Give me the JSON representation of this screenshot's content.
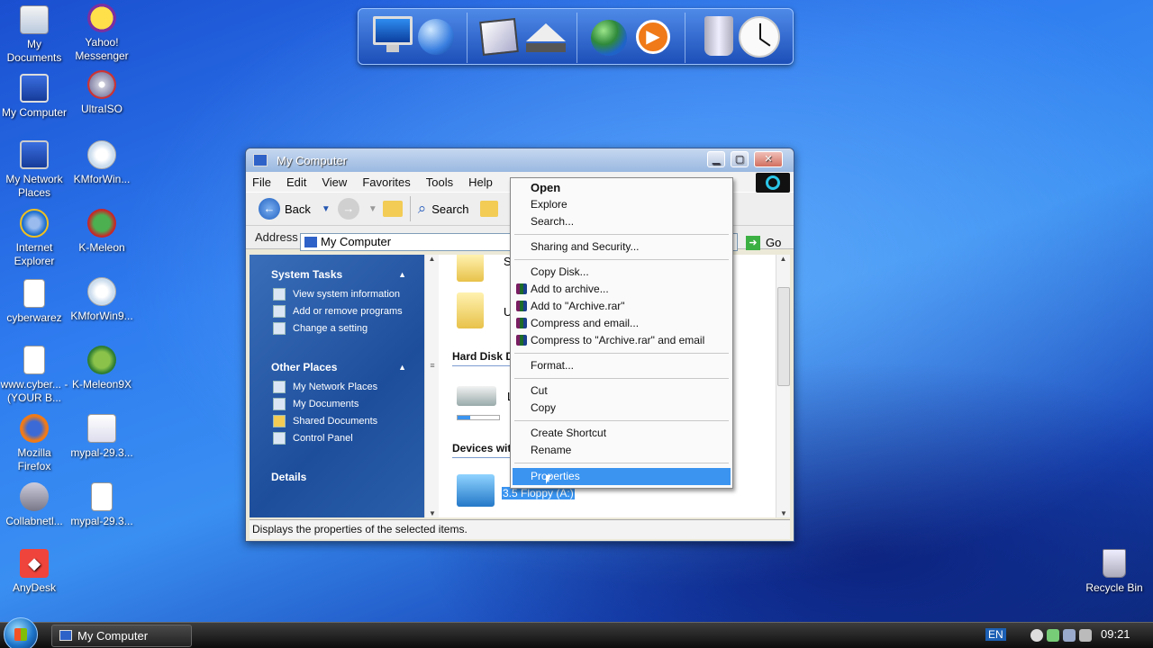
{
  "desktop": {
    "icons": [
      {
        "label": "My Documents",
        "icon": "my-documents-icon"
      },
      {
        "label": "Yahoo! Messenger",
        "icon": "yahoo-messenger-icon"
      },
      {
        "label": "My Computer",
        "icon": "my-computer-icon"
      },
      {
        "label": "UltraISO",
        "icon": "ultraiso-icon"
      },
      {
        "label": "My Network Places",
        "icon": "network-places-icon"
      },
      {
        "label": "KMforWin...",
        "icon": "kmforwin-icon"
      },
      {
        "label": "Internet Explorer",
        "icon": "internet-explorer-icon"
      },
      {
        "label": "K-Meleon",
        "icon": "k-meleon-icon"
      },
      {
        "label": "cyberwarez",
        "icon": "text-file-icon"
      },
      {
        "label": "KMforWin9...",
        "icon": "kmforwin-icon"
      },
      {
        "label": "www.cyber... - (YOUR B...",
        "icon": "shortcut-icon"
      },
      {
        "label": "K-Meleon9X",
        "icon": "k-meleon-icon"
      },
      {
        "label": "Mozilla Firefox",
        "icon": "firefox-icon"
      },
      {
        "label": "mypal-29.3...",
        "icon": "mypal-icon"
      },
      {
        "label": "Collabnetl...",
        "icon": "collabnet-icon"
      },
      {
        "label": "mypal-29.3...",
        "icon": "file-icon"
      },
      {
        "label": "AnyDesk",
        "icon": "anydesk-icon"
      },
      {
        "label": "Recycle Bin",
        "icon": "recycle-bin-icon"
      }
    ]
  },
  "dock": {
    "items": [
      "monitor-icon",
      "globe-network-icon",
      "drawing-tools-icon",
      "eject-drive-icon",
      "earth-icon",
      "media-player-icon",
      "trash-icon",
      "clock-icon"
    ]
  },
  "window": {
    "title": "My Computer",
    "menu": [
      "File",
      "Edit",
      "View",
      "Favorites",
      "Tools",
      "Help"
    ],
    "toolbar": {
      "back": "Back",
      "search": "Search"
    },
    "address": {
      "label": "Address",
      "value": "My Computer",
      "go": "Go"
    },
    "left_pane": {
      "system_tasks": {
        "title": "System Tasks",
        "items": [
          "View system information",
          "Add or remove programs",
          "Change a setting"
        ]
      },
      "other_places": {
        "title": "Other Places",
        "items": [
          "My Network Places",
          "My Documents",
          "Shared Documents",
          "Control Panel"
        ]
      },
      "details": {
        "title": "Details"
      }
    },
    "right_pane": {
      "folder1": "Sh",
      "folder2": "U",
      "hard_disk_header": "Hard Disk D",
      "local_disk": "Lo",
      "devices_header": "Devices wit",
      "floppy": "3.5 Floppy (A:)"
    },
    "status": "Displays the properties of the selected items."
  },
  "context_menu": {
    "items": [
      {
        "label": "Open",
        "bold": true
      },
      {
        "label": "Explore"
      },
      {
        "label": "Search..."
      },
      {
        "label": "Sharing and Security..."
      },
      {
        "label": "Copy Disk..."
      },
      {
        "label": "Add to archive...",
        "rar": true
      },
      {
        "label": "Add to \"Archive.rar\"",
        "rar": true
      },
      {
        "label": "Compress and email...",
        "rar": true
      },
      {
        "label": "Compress to \"Archive.rar\" and email",
        "rar": true
      },
      {
        "label": "Format..."
      },
      {
        "label": "Cut"
      },
      {
        "label": "Copy"
      },
      {
        "label": "Create Shortcut"
      },
      {
        "label": "Rename"
      },
      {
        "label": "Properties",
        "highlighted": true
      }
    ]
  },
  "taskbar": {
    "task": "My Computer",
    "language": "EN",
    "time": "09:21"
  },
  "colors": {
    "selection": "#3a94f0",
    "task_pane": "#1d4e9c"
  }
}
